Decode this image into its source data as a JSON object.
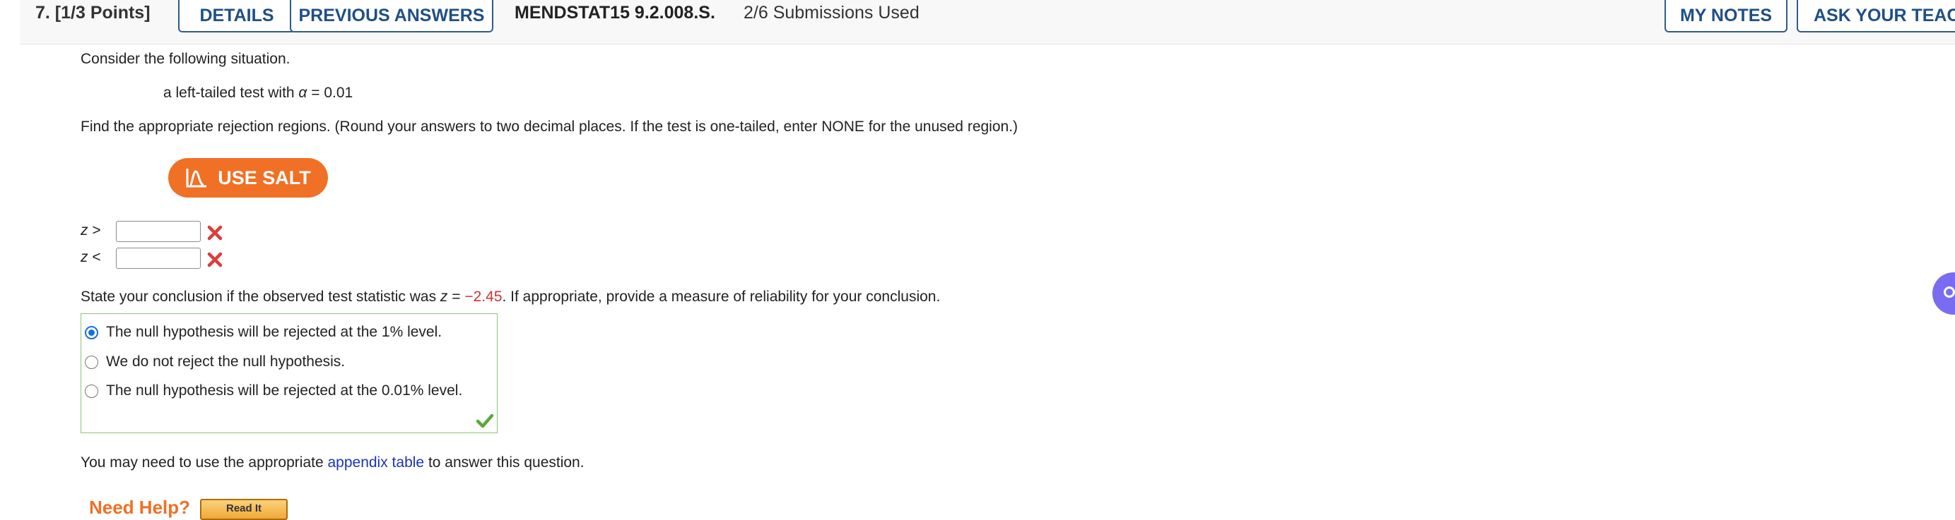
{
  "header": {
    "question_number": "7. [1/3 Points]",
    "details_label": "DETAILS",
    "previous_answers_label": "PREVIOUS ANSWERS",
    "problem_code": "MENDSTAT15 9.2.008.S.",
    "submissions": "2/6 Submissions Used",
    "my_notes_label": "MY NOTES",
    "ask_teacher_label": "ASK YOUR TEACH"
  },
  "question": {
    "intro": "Consider the following situation.",
    "situation_prefix": "a left-tailed test with ",
    "alpha_symbol": "α",
    "situation_suffix": " = 0.01",
    "instructions": "Find the appropriate rejection regions. (Round your answers to two decimal places. If the test is one-tailed, enter NONE for the unused region.)",
    "salt_label": "USE SALT",
    "z_symbol": "z",
    "greater_sign": ">",
    "less_sign": "<",
    "z_greater_value": "",
    "z_less_value": "",
    "conclusion_prefix": "State your conclusion if the observed test statistic was ",
    "conclusion_equals": " = ",
    "conclusion_value": "−2.45",
    "conclusion_suffix": ". If appropriate, provide a measure of reliability for your conclusion.",
    "options": [
      {
        "label": "The null hypothesis will be rejected at the 1% level.",
        "selected": true
      },
      {
        "label": "We do not reject the null hypothesis.",
        "selected": false
      },
      {
        "label": "The null hypothesis will be rejected at the 0.01% level.",
        "selected": false
      }
    ],
    "appendix_prefix": "You may need to use the appropriate ",
    "appendix_link": "appendix table",
    "appendix_suffix": " to answer this question.",
    "need_help": "Need Help?",
    "read_it": "Read It"
  },
  "colors": {
    "salt_orange": "#f07025",
    "incorrect_red": "#e03a3a",
    "correct_green": "#5aa83a",
    "link_blue": "#1a34b8",
    "header_button_blue": "#1f4f86"
  }
}
